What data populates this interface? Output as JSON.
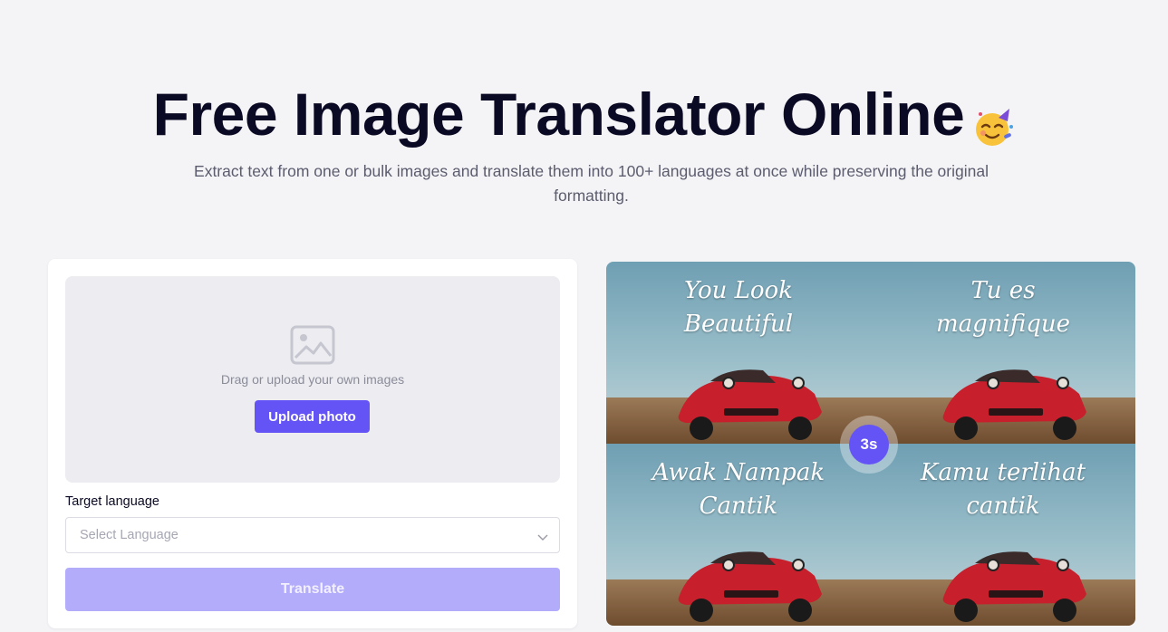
{
  "hero": {
    "title": "Free Image Translator Online",
    "emoji_icon": "party-face-icon",
    "subtitle": "Extract text from one or bulk images and translate them into 100+ languages at once while preserving the original formatting."
  },
  "uploader": {
    "icon": "image-icon",
    "drop_text": "Drag or upload your own images",
    "upload_button": "Upload photo",
    "target_language_label": "Target language",
    "select_placeholder": "Select Language",
    "translate_button": "Translate"
  },
  "preview": {
    "quadrants": [
      {
        "text": "You Look\nBeautiful"
      },
      {
        "text": "Tu es\nmagnifique"
      },
      {
        "text": "Awak Nampak\nCantik"
      },
      {
        "text": "Kamu terlihat\ncantik"
      }
    ],
    "timer": "3s"
  },
  "colors": {
    "accent": "#6454f6",
    "accent_disabled": "#b3acfb",
    "background": "#f4f4f7",
    "title": "#0b0a24"
  }
}
